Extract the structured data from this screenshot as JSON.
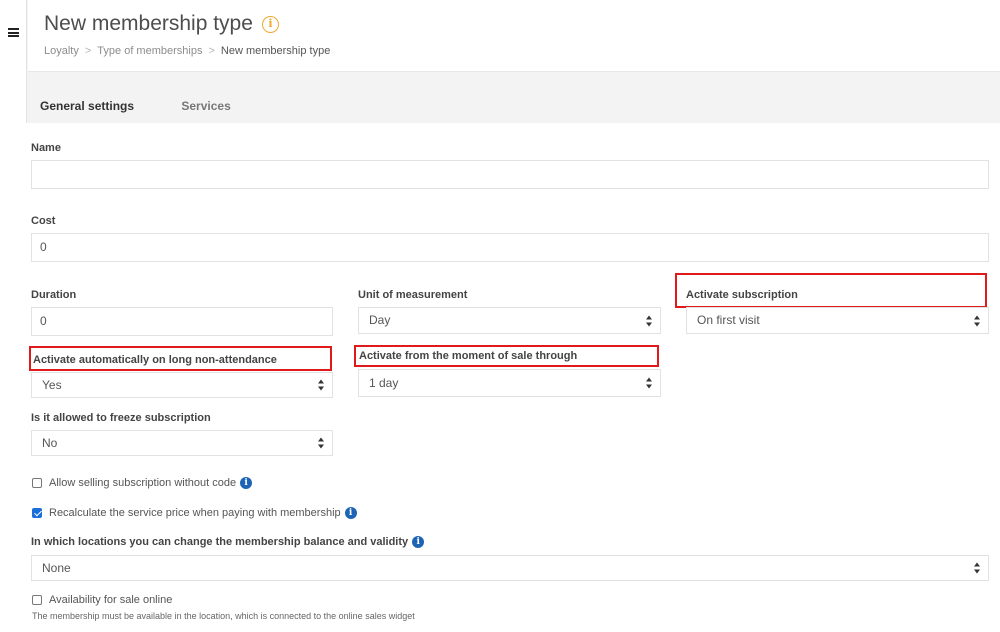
{
  "header": {
    "title": "New membership type",
    "info_symbol": "i",
    "breadcrumb": [
      "Loyalty",
      "Type of memberships",
      "New membership type"
    ],
    "breadcrumb_separator": ">"
  },
  "tabs": [
    {
      "label": "General settings",
      "active": true
    },
    {
      "label": "Services",
      "active": false
    }
  ],
  "form": {
    "name": {
      "label": "Name",
      "value": ""
    },
    "cost": {
      "label": "Cost",
      "value": "0"
    },
    "duration": {
      "label": "Duration",
      "value": "0"
    },
    "unit": {
      "label": "Unit of measurement",
      "value": "Day"
    },
    "activate_subscription": {
      "label": "Activate subscription",
      "value": "On first visit"
    },
    "activate_auto": {
      "label": "Activate automatically on long non-attendance",
      "value": "Yes"
    },
    "activate_from_sale": {
      "label": "Activate from the moment of sale through",
      "value": "1 day"
    },
    "freeze": {
      "label": "Is it allowed to freeze subscription",
      "value": "No"
    },
    "allow_without_code": {
      "label": "Allow selling subscription without code",
      "checked": false
    },
    "recalculate_price": {
      "label": "Recalculate the service price when paying with membership",
      "checked": true
    },
    "locations": {
      "label": "In which locations you can change the membership balance and validity",
      "value": "None"
    },
    "online_sale": {
      "label": "Availability for sale online",
      "checked": false,
      "note": "The membership must be available in the location, which is connected to the online sales widget"
    }
  },
  "colors": {
    "highlight": "#e01a1a",
    "accent": "#1a6fd9",
    "info_orange": "#f0a830",
    "info_blue": "#1e64b4"
  }
}
